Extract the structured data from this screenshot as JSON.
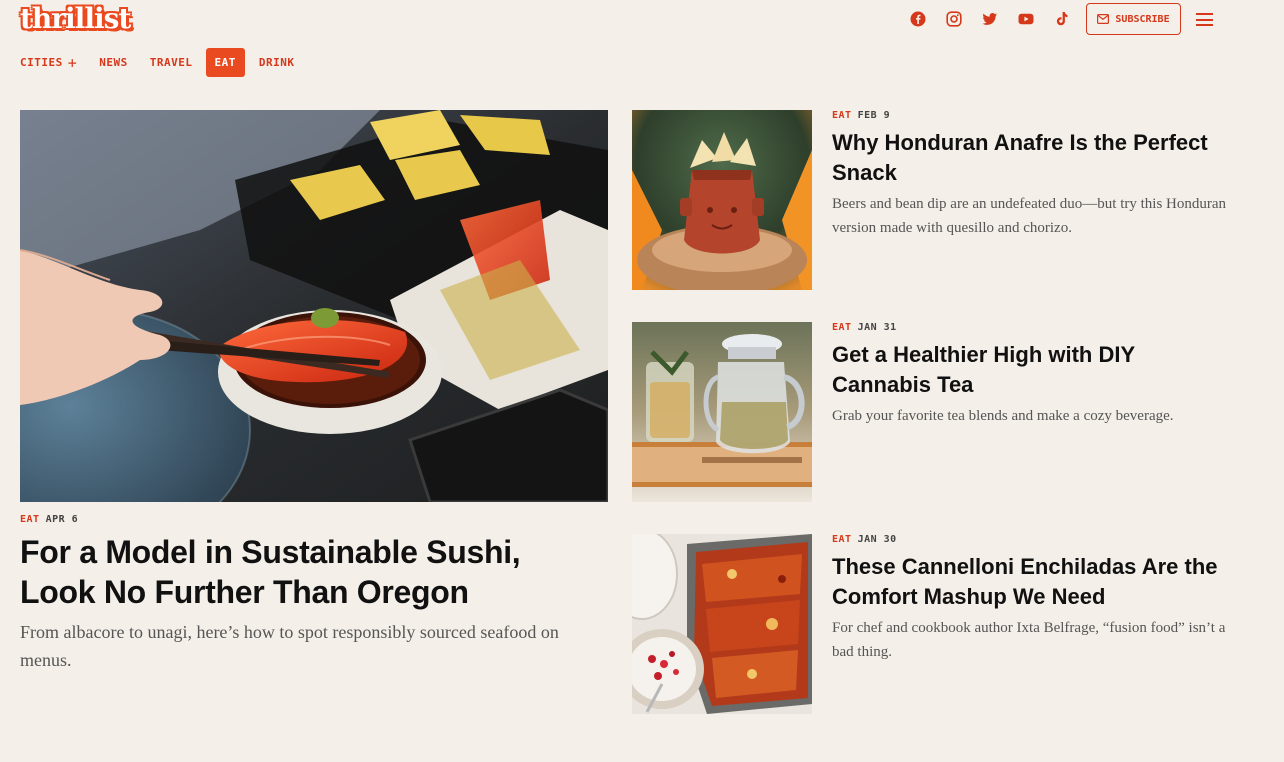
{
  "header": {
    "logo": "thrillist",
    "subscribe_label": "SUBSCRIBE",
    "social_icons": [
      "facebook-icon",
      "instagram-icon",
      "twitter-icon",
      "youtube-icon",
      "tiktok-icon"
    ],
    "brand_color": "#ea4a1f"
  },
  "nav": {
    "items": [
      {
        "label": "CITIES"
      },
      {
        "label": "NEWS"
      },
      {
        "label": "TRAVEL"
      },
      {
        "label": "EAT",
        "active": true
      },
      {
        "label": "DRINK"
      }
    ],
    "cities_plus": "+"
  },
  "featured": {
    "category": "EAT",
    "date": "APR 6",
    "headline": "For a Model in Sustainable Sushi, Look No Further Than Oregon",
    "dek": "From albacore to unagi, here’s how to spot responsibly sourced seafood on menus."
  },
  "articles": [
    {
      "category": "EAT",
      "date": "FEB 9",
      "headline": "Why Honduran Anafre Is the Perfect Snack",
      "dek": "Beers and bean dip are an undefeated duo—but try this Honduran version made with quesillo and chorizo."
    },
    {
      "category": "EAT",
      "date": "JAN 31",
      "headline": "Get a Healthier High with DIY Cannabis Tea",
      "dek": "Grab your favorite tea blends and make a cozy beverage."
    },
    {
      "category": "EAT",
      "date": "JAN 30",
      "headline": "These Cannelloni Enchiladas Are the Comfort Mashup We Need",
      "dek": "For chef and cookbook author Ixta Belfrage, “fusion food” isn’t a bad thing."
    }
  ]
}
